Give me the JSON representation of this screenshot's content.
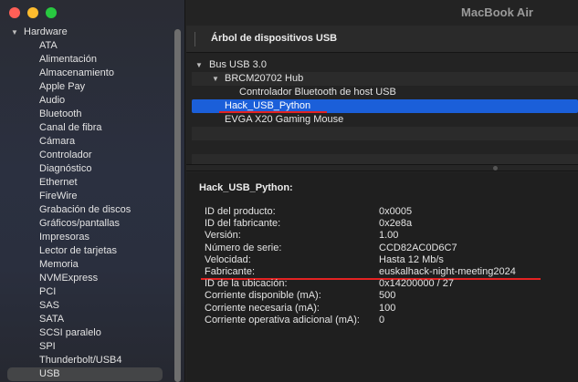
{
  "window": {
    "title": "MacBook Air"
  },
  "sidebar": {
    "group": "Hardware",
    "items": [
      "ATA",
      "Alimentación",
      "Almacenamiento",
      "Apple Pay",
      "Audio",
      "Bluetooth",
      "Canal de fibra",
      "Cámara",
      "Controlador",
      "Diagnóstico",
      "Ethernet",
      "FireWire",
      "Grabación de discos",
      "Gráficos/pantallas",
      "Impresoras",
      "Lector de tarjetas",
      "Memoria",
      "NVMExpress",
      "PCI",
      "SAS",
      "SATA",
      "SCSI paralelo",
      "SPI",
      "Thunderbolt/USB4",
      "USB"
    ],
    "selected": "USB"
  },
  "section": {
    "title": "Árbol de dispositivos USB"
  },
  "tree": [
    {
      "label": "Bus USB 3.0",
      "level": 0,
      "expanded": true
    },
    {
      "label": "BRCM20702 Hub",
      "level": 1,
      "expanded": true
    },
    {
      "label": "Controlador Bluetooth de host USB",
      "level": 2
    },
    {
      "label": "Hack_USB_Python",
      "level": 1,
      "selected": true
    },
    {
      "label": "EVGA X20 Gaming Mouse",
      "level": 1
    }
  ],
  "details": {
    "heading": "Hack_USB_Python:",
    "properties": [
      {
        "key": "ID del producto:",
        "value": "0x0005"
      },
      {
        "key": "ID del fabricante:",
        "value": "0x2e8a"
      },
      {
        "key": "Versión:",
        "value": "1.00"
      },
      {
        "key": "Número de serie:",
        "value": "CCD82AC0D6C7"
      },
      {
        "key": "Velocidad:",
        "value": "Hasta 12 Mb/s"
      },
      {
        "key": "Fabricante:",
        "value": "euskalhack-night-meeting2024"
      },
      {
        "key": "ID de la ubicación:",
        "value": "0x14200000 / 27"
      },
      {
        "key": "Corriente disponible (mA):",
        "value": "500"
      },
      {
        "key": "Corriente necesaria (mA):",
        "value": "100"
      },
      {
        "key": "Corriente operativa adicional (mA):",
        "value": "0"
      }
    ]
  },
  "colors": {
    "selection": "#1b5fd9",
    "annotation": "#e32222",
    "traffic_red": "#ff5f57",
    "traffic_yellow": "#febc2e",
    "traffic_green": "#28c840"
  }
}
